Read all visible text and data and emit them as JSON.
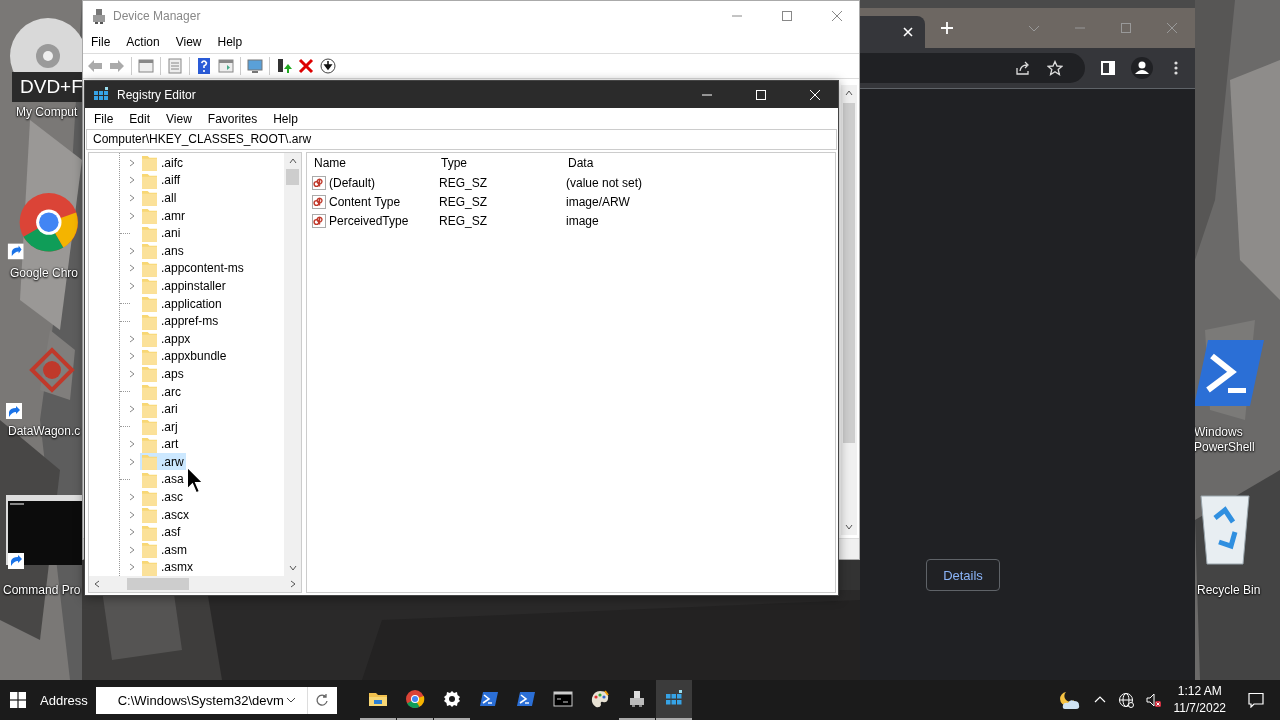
{
  "desktop": {
    "icons": [
      {
        "kind": "disc",
        "badge": "DVD+F",
        "label": "My Comput"
      },
      {
        "kind": "chrome",
        "label": "Google Chro"
      },
      {
        "kind": "app"
      },
      {
        "kind": "shortcut",
        "label": "DataWagon.c"
      },
      {
        "kind": "console",
        "label": "Command Pro"
      },
      {
        "kind": "powershell",
        "label": "Windows PowerShell"
      },
      {
        "kind": "recycle",
        "label": "Recycle Bin"
      }
    ]
  },
  "browser": {
    "button": "Details"
  },
  "device_manager": {
    "title": "Device Manager",
    "menu": [
      "File",
      "Action",
      "View",
      "Help"
    ]
  },
  "registry_editor": {
    "title": "Registry Editor",
    "menu": [
      "File",
      "Edit",
      "View",
      "Favorites",
      "Help"
    ],
    "address": "Computer\\HKEY_CLASSES_ROOT\\.arw",
    "tree": [
      {
        "label": ".aifc",
        "expandable": true,
        "selected": false
      },
      {
        "label": ".aiff",
        "expandable": true,
        "selected": false
      },
      {
        "label": ".all",
        "expandable": true,
        "selected": false
      },
      {
        "label": ".amr",
        "expandable": true,
        "selected": false
      },
      {
        "label": ".ani",
        "expandable": false,
        "selected": false
      },
      {
        "label": ".ans",
        "expandable": true,
        "selected": false
      },
      {
        "label": ".appcontent-ms",
        "expandable": true,
        "selected": false
      },
      {
        "label": ".appinstaller",
        "expandable": true,
        "selected": false
      },
      {
        "label": ".application",
        "expandable": false,
        "selected": false
      },
      {
        "label": ".appref-ms",
        "expandable": false,
        "selected": false
      },
      {
        "label": ".appx",
        "expandable": true,
        "selected": false
      },
      {
        "label": ".appxbundle",
        "expandable": true,
        "selected": false
      },
      {
        "label": ".aps",
        "expandable": true,
        "selected": false
      },
      {
        "label": ".arc",
        "expandable": false,
        "selected": false
      },
      {
        "label": ".ari",
        "expandable": true,
        "selected": false
      },
      {
        "label": ".arj",
        "expandable": false,
        "selected": false
      },
      {
        "label": ".art",
        "expandable": true,
        "selected": false
      },
      {
        "label": ".arw",
        "expandable": true,
        "selected": true
      },
      {
        "label": ".asa",
        "expandable": false,
        "selected": false
      },
      {
        "label": ".asc",
        "expandable": true,
        "selected": false
      },
      {
        "label": ".ascx",
        "expandable": true,
        "selected": false
      },
      {
        "label": ".asf",
        "expandable": true,
        "selected": false
      },
      {
        "label": ".asm",
        "expandable": true,
        "selected": false
      },
      {
        "label": ".asmx",
        "expandable": true,
        "selected": false
      }
    ],
    "columns": [
      "Name",
      "Type",
      "Data"
    ],
    "values": [
      {
        "name": "(Default)",
        "type": "REG_SZ",
        "data": "(value not set)"
      },
      {
        "name": "Content Type",
        "type": "REG_SZ",
        "data": "image/ARW"
      },
      {
        "name": "PerceivedType",
        "type": "REG_SZ",
        "data": "image"
      }
    ]
  },
  "taskbar": {
    "address_label": "Address",
    "address": "C:\\Windows\\System32\\devm",
    "apps": [
      {
        "kind": "explorer",
        "running": true,
        "selected": false
      },
      {
        "kind": "chrome",
        "running": true,
        "selected": false
      },
      {
        "kind": "settings",
        "running": true,
        "selected": false
      },
      {
        "kind": "powershell",
        "running": false,
        "selected": false
      },
      {
        "kind": "powershell",
        "running": false,
        "selected": false
      },
      {
        "kind": "console",
        "running": false,
        "selected": false
      },
      {
        "kind": "paint",
        "running": false,
        "selected": false
      },
      {
        "kind": "devices",
        "running": true,
        "selected": false
      },
      {
        "kind": "registry",
        "running": true,
        "selected": true
      }
    ],
    "time": "1:12 AM",
    "date": "11/7/2022"
  }
}
